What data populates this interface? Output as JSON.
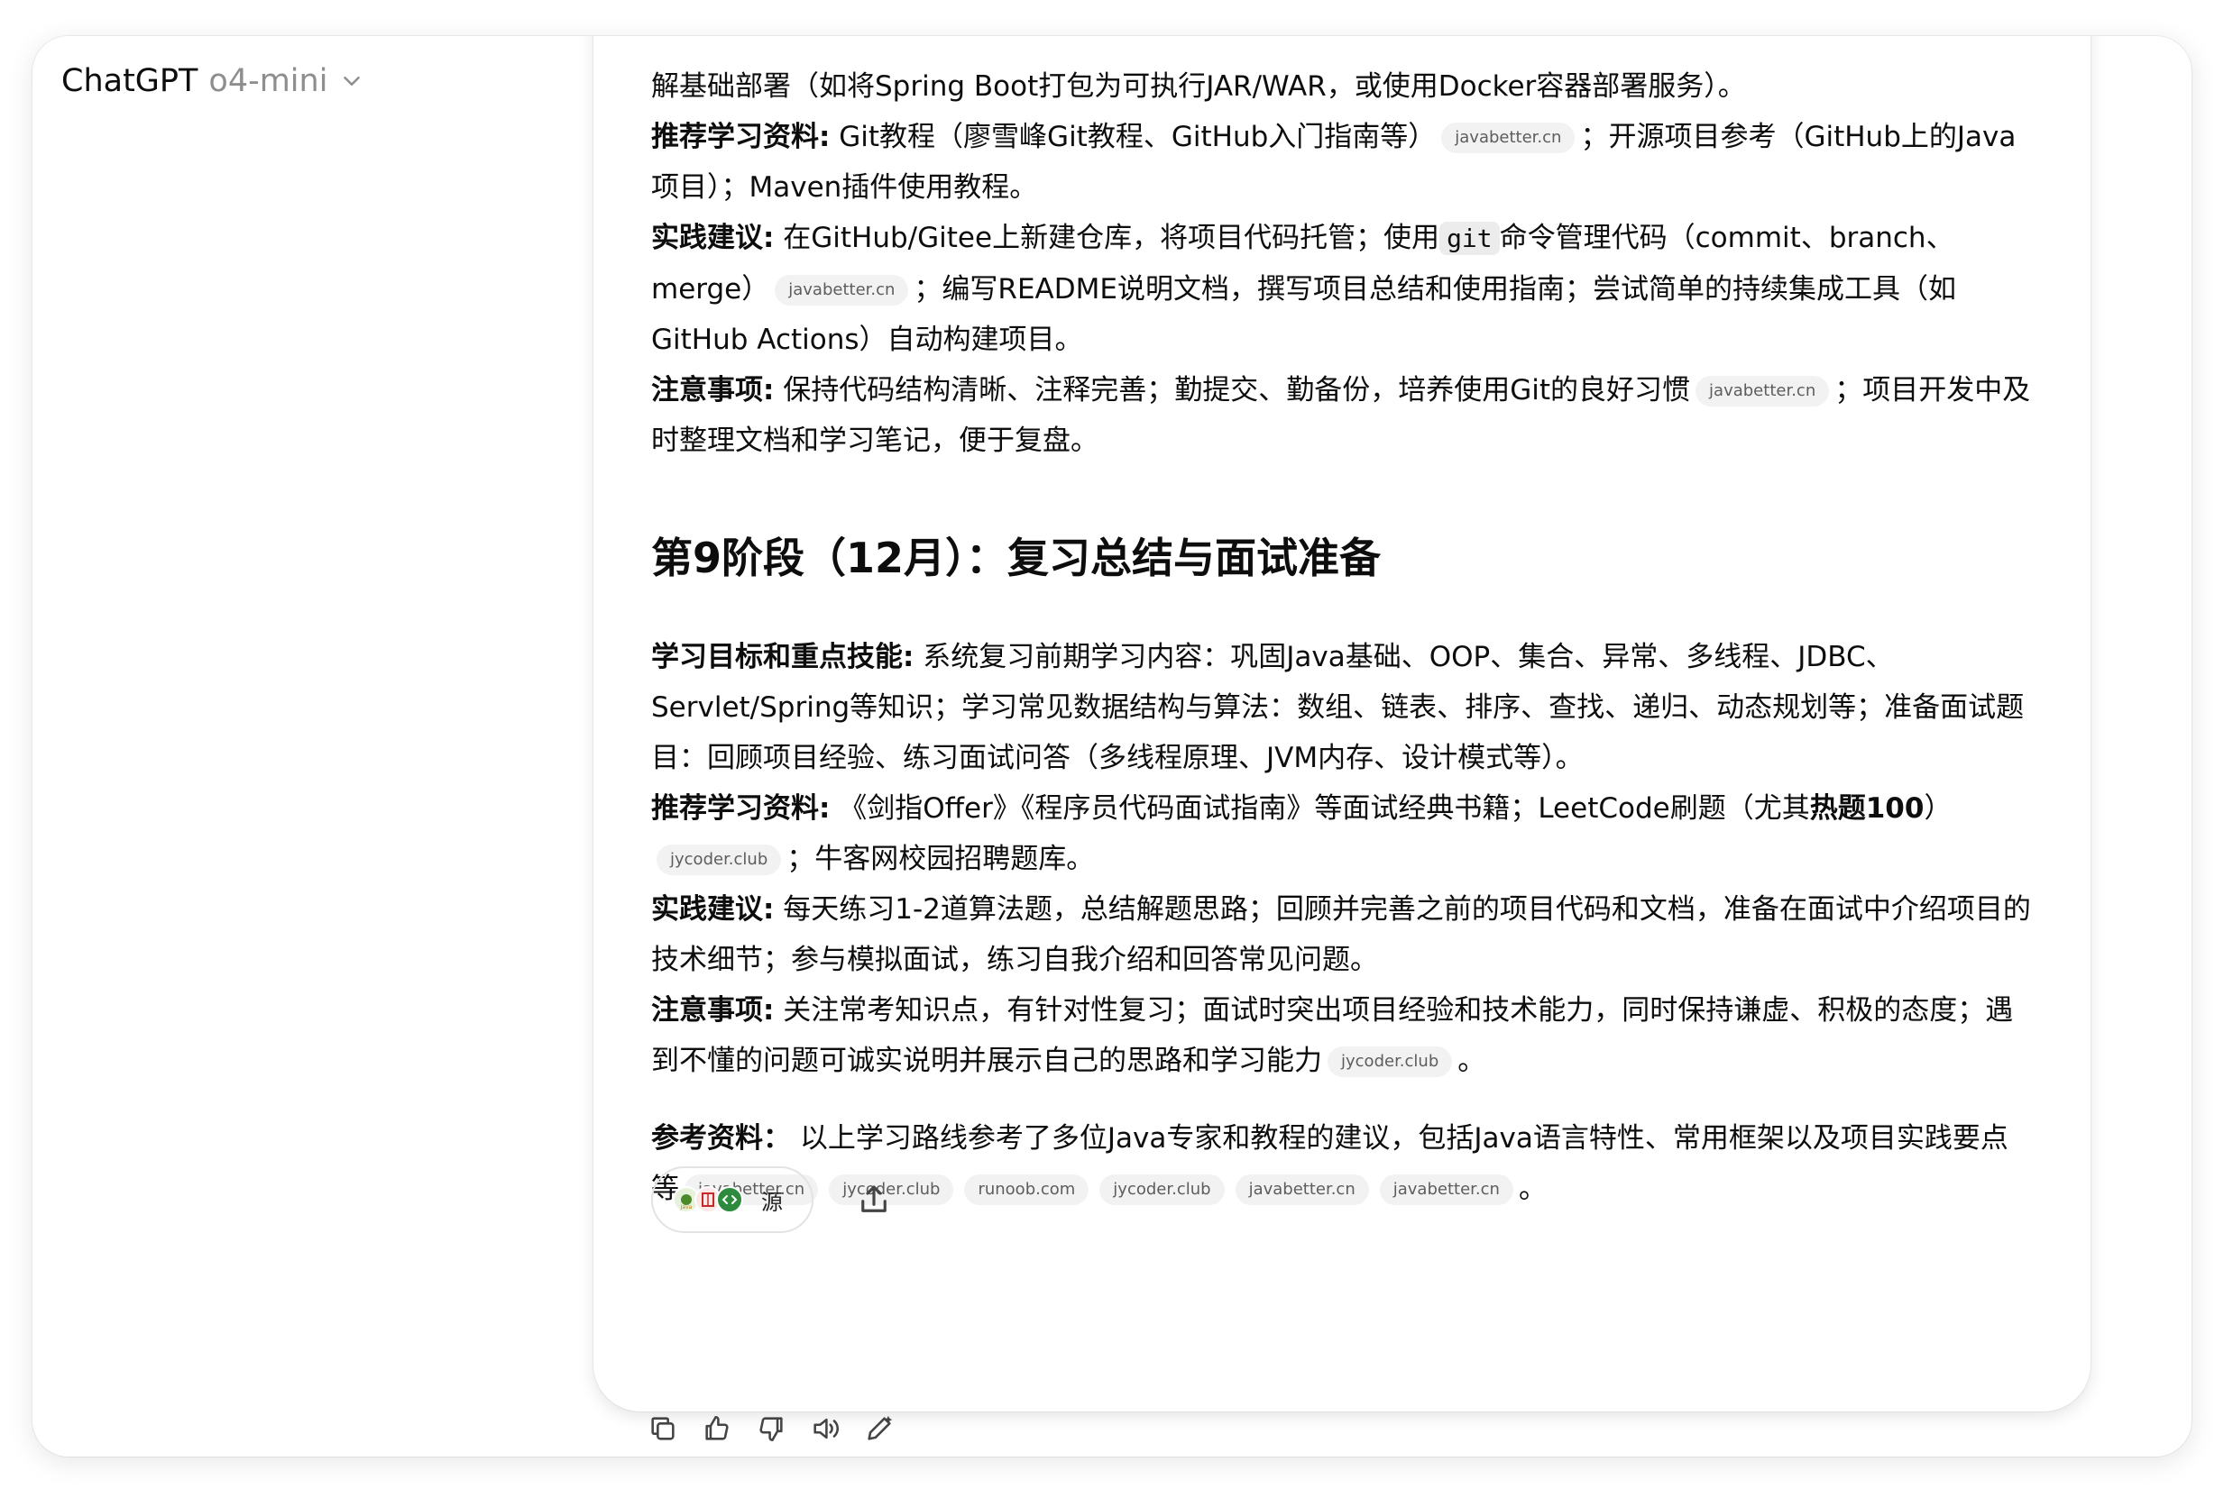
{
  "header": {
    "app_name": "ChatGPT",
    "model": "o4-mini"
  },
  "content": {
    "p1": {
      "text": "解基础部署（如将Spring Boot打包为可执行JAR/WAR，或使用Docker容器部署服务）。"
    },
    "p2": {
      "label": "推荐学习资料:",
      "text_a": " Git教程（廖雪峰Git教程、GitHub入门指南等）",
      "cite": "javabetter.cn",
      "text_b": "；开源项目参考（GitHub上的Java项目）；Maven插件使用教程。"
    },
    "p3": {
      "label": "实践建议:",
      "text_a": " 在GitHub/Gitee上新建仓库，将项目代码托管；使用",
      "code": "git",
      "text_b": "命令管理代码（commit、branch、merge）",
      "cite": "javabetter.cn",
      "text_c": "；编写README说明文档，撰写项目总结和使用指南；尝试简单的持续集成工具（如GitHub Actions）自动构建项目。"
    },
    "p4": {
      "label": "注意事项:",
      "text_a": " 保持代码结构清晰、注释完善；勤提交、勤备份，培养使用Git的良好习惯",
      "cite": "javabetter.cn",
      "text_b": "；项目开发中及时整理文档和学习笔记，便于复盘。"
    },
    "heading": "第9阶段（12月）：复习总结与面试准备",
    "p5": {
      "label": "学习目标和重点技能:",
      "text": " 系统复习前期学习内容：巩固Java基础、OOP、集合、异常、多线程、JDBC、Servlet/Spring等知识；学习常见数据结构与算法：数组、链表、排序、查找、递归、动态规划等；准备面试题目：回顾项目经验、练习面试问答（多线程原理、JVM内存、设计模式等）。"
    },
    "p6": {
      "label": "推荐学习资料:",
      "text_a": " 《剑指Offer》《程序员代码面试指南》等面试经典书籍；LeetCode刷题（尤其",
      "bold": "热题100",
      "text_b": "）",
      "cite": "jycoder.club",
      "text_c": "；牛客网校园招聘题库。"
    },
    "p7": {
      "label": "实践建议:",
      "text": " 每天练习1-2道算法题，总结解题思路；回顾并完善之前的项目代码和文档，准备在面试中介绍项目的技术细节；参与模拟面试，练习自我介绍和回答常见问题。"
    },
    "p8": {
      "label": "注意事项:",
      "text_a": " 关注常考知识点，有针对性复习；面试时突出项目经验和技术能力，同时保持谦虚、积极的态度；遇到不懂的问题可诚实说明并展示自己的思路和学习能力",
      "cite": "jycoder.club",
      "text_b": "。"
    },
    "p9": {
      "label": "参考资料：",
      "text": " 以上学习路线参考了多位Java专家和教程的建议，包括Java语言特性、常用框架以及项目实践要点等",
      "cites": [
        "javabetter.cn",
        "jycoder.club",
        "runoob.com",
        "jycoder.club",
        "javabetter.cn",
        "javabetter.cn"
      ],
      "end": "。"
    }
  },
  "sources_button": {
    "label": "源",
    "icons": [
      "java-favicon",
      "book-favicon",
      "code-favicon"
    ]
  },
  "icons": {
    "chevron": "chevron-down-icon",
    "share": "share-icon",
    "actions": [
      "copy-icon",
      "thumbs-up-icon",
      "thumbs-down-icon",
      "read-aloud-icon",
      "edit-icon"
    ]
  }
}
